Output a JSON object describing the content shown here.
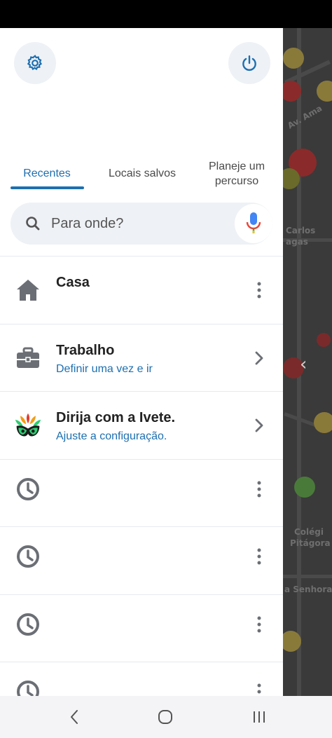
{
  "tabs": [
    {
      "label": "Recentes"
    },
    {
      "label": "Locais salvos"
    },
    {
      "label": "Planeje um percurso"
    }
  ],
  "search": {
    "placeholder": "Para onde?"
  },
  "items": [
    {
      "title": "Casa",
      "subtitle": "",
      "icon": "home-icon",
      "action": "more-icon"
    },
    {
      "title": "Trabalho",
      "subtitle": "Definir uma vez e ir",
      "icon": "briefcase-icon",
      "action": "chevron-right-icon"
    },
    {
      "title": "Dirija com a Ivete.",
      "subtitle": "Ajuste a configuração.",
      "icon": "carnival-mask-icon",
      "action": "chevron-right-icon"
    }
  ],
  "recent_count": 4,
  "map_labels": [
    "Av. Ama",
    "Carlos",
    "agas",
    "Colégi",
    "Pitágora",
    "a Senhora"
  ],
  "colors": {
    "accent": "#1d6fb0",
    "icon_gray": "#6b6f75",
    "surface": "#eef1f5"
  }
}
